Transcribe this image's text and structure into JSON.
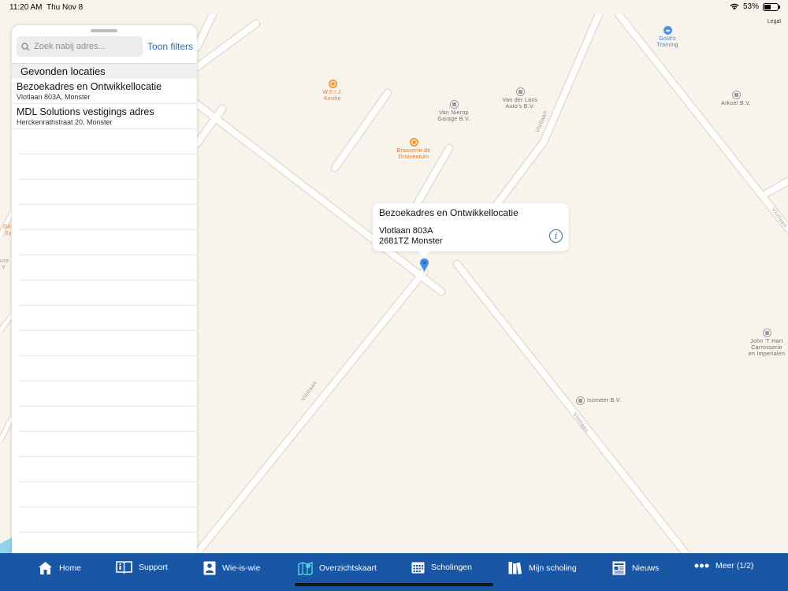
{
  "status": {
    "time": "11:20 AM",
    "date": "Thu Nov 8",
    "battery": "53%",
    "battery_level": 0.53
  },
  "map": {
    "legal": "Legal",
    "pois": [
      {
        "lines": [
          "Gold's",
          "Training"
        ],
        "style": "blue",
        "icon": "dumbbell-icon"
      },
      {
        "lines": [
          "W.F.I.J.",
          "Kentie"
        ],
        "style": "orange",
        "icon": "store-icon"
      },
      {
        "lines": [
          "Van Nierop",
          "Garage B.V."
        ],
        "style": "grey",
        "icon": "car-icon"
      },
      {
        "lines": [
          "Van der Lans",
          "Auto's B.V."
        ],
        "style": "grey",
        "icon": "car-icon"
      },
      {
        "lines": [
          "Arkoel B.V."
        ],
        "style": "grey",
        "icon": "place-icon"
      },
      {
        "lines": [
          "Brasserie de",
          "Druiventuin"
        ],
        "style": "orange",
        "icon": "restaurant-icon"
      },
      {
        "lines": [
          "John 'T Hart",
          "Carrosserie",
          "en Imperialen"
        ],
        "style": "grey",
        "icon": "place-icon"
      },
      {
        "lines": [
          "Isomeer B.V."
        ],
        "style": "grey",
        "icon": "place-icon"
      }
    ],
    "road_labels": [
      "Vlotlaan",
      "Vlotlaan",
      "Vlotlaan",
      "Vlotlaan"
    ],
    "edge_labels": [
      "Oil",
      "Sy",
      "ure",
      "V"
    ]
  },
  "callout": {
    "title": "Bezoekadres en Ontwikkellocatie",
    "line1": "Vlotlaan 803A",
    "line2": "2681TZ Monster",
    "info_icon": "i"
  },
  "panel": {
    "search_placeholder": "Zoek nabij adres...",
    "filters_label": "Toon filters",
    "section_title": "Gevonden locaties",
    "results": [
      {
        "title": "Bezoekadres en Ontwikkellocatie",
        "subtitle": "Vlotlaan 803A, Monster"
      },
      {
        "title": "MDL Solutions vestigings adres",
        "subtitle": "Herckenrathstraat 20, Monster"
      }
    ]
  },
  "tabs": [
    {
      "label": "Home",
      "icon": "home-icon"
    },
    {
      "label": "Support",
      "icon": "book-info-icon"
    },
    {
      "label": "Wie-is-wie",
      "icon": "person-card-icon"
    },
    {
      "label": "Overzichtskaart",
      "icon": "map-icon",
      "active": true
    },
    {
      "label": "Scholingen",
      "icon": "calendar-icon"
    },
    {
      "label": "Mijn scholing",
      "icon": "books-icon"
    },
    {
      "label": "Nieuws",
      "icon": "newspaper-icon"
    },
    {
      "label": "Meer (1/2)",
      "icon": "more-icon"
    }
  ],
  "colors": {
    "tabbar": "#1a56a6",
    "map_bg": "#f8f4ec",
    "accent": "#2b6cb5",
    "active_tab_icon": "#4fd1e0"
  }
}
